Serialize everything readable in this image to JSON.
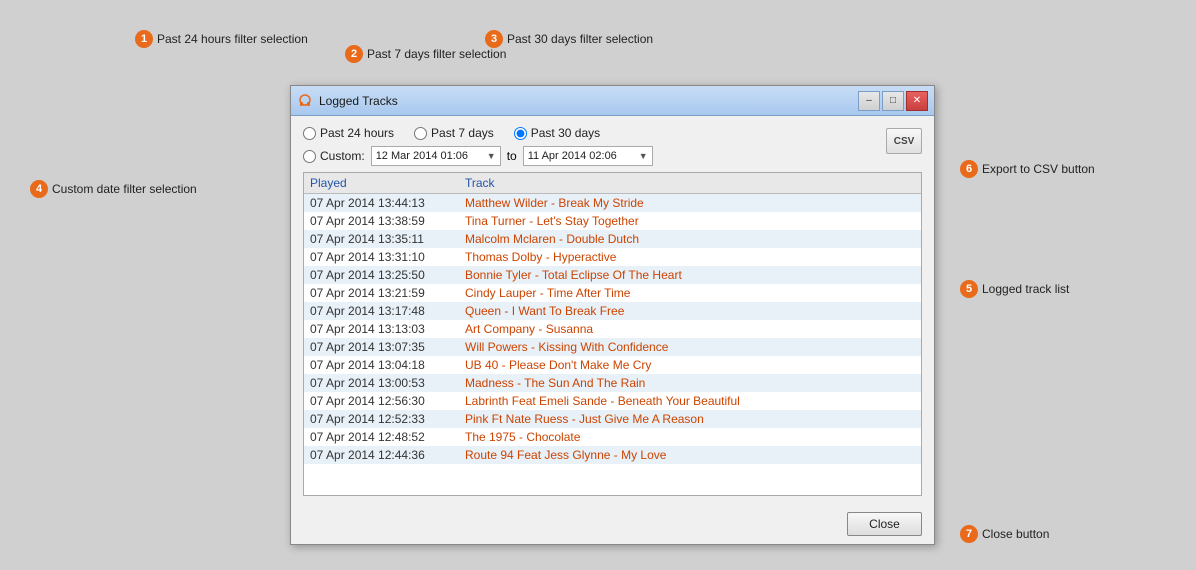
{
  "annotations": {
    "badge1": "1",
    "badge2": "2",
    "badge3": "3",
    "badge4": "4",
    "badge5": "5",
    "badge6": "6",
    "badge7": "7",
    "label1": "Past 24 hours filter selection",
    "label2": "Past 7 days filter selection",
    "label3": "Past 30 days filter selection",
    "label4": "Custom date filter selection",
    "label5": "Logged track list",
    "label6": "Export to CSV button",
    "label7": "Close button"
  },
  "window": {
    "title": "Logged Tracks",
    "filters": {
      "past24": "Past 24 hours",
      "past7": "Past 7 days",
      "past30": "Past 30 days",
      "custom": "Custom:",
      "customFrom": "12 Mar 2014 01:06",
      "to": "to",
      "customTo": "11 Apr 2014 02:06"
    },
    "csvLabel": "CSV",
    "listHeaders": {
      "played": "Played",
      "track": "Track"
    },
    "tracks": [
      {
        "played": "07 Apr 2014 13:44:13",
        "track": "Matthew Wilder - Break My Stride"
      },
      {
        "played": "07 Apr 2014 13:38:59",
        "track": "Tina Turner - Let's Stay Together"
      },
      {
        "played": "07 Apr 2014 13:35:11",
        "track": "Malcolm Mclaren - Double Dutch"
      },
      {
        "played": "07 Apr 2014 13:31:10",
        "track": "Thomas Dolby - Hyperactive"
      },
      {
        "played": "07 Apr 2014 13:25:50",
        "track": "Bonnie Tyler - Total Eclipse Of The Heart"
      },
      {
        "played": "07 Apr 2014 13:21:59",
        "track": "Cindy Lauper - Time After Time"
      },
      {
        "played": "07 Apr 2014 13:17:48",
        "track": "Queen - I Want To Break Free"
      },
      {
        "played": "07 Apr 2014 13:13:03",
        "track": "Art Company - Susanna"
      },
      {
        "played": "07 Apr 2014 13:07:35",
        "track": "Will Powers - Kissing With Confidence"
      },
      {
        "played": "07 Apr 2014 13:04:18",
        "track": "UB 40 - Please Don't Make Me Cry"
      },
      {
        "played": "07 Apr 2014 13:00:53",
        "track": "Madness - The Sun And The Rain"
      },
      {
        "played": "07 Apr 2014 12:56:30",
        "track": "Labrinth Feat Emeli Sande - Beneath Your Beautiful"
      },
      {
        "played": "07 Apr 2014 12:52:33",
        "track": "Pink Ft Nate Ruess - Just Give Me A Reason"
      },
      {
        "played": "07 Apr 2014 12:48:52",
        "track": "The 1975 - Chocolate"
      },
      {
        "played": "07 Apr 2014 12:44:36",
        "track": "Route 94 Feat Jess Glynne - My Love"
      }
    ],
    "closeButton": "Close"
  }
}
